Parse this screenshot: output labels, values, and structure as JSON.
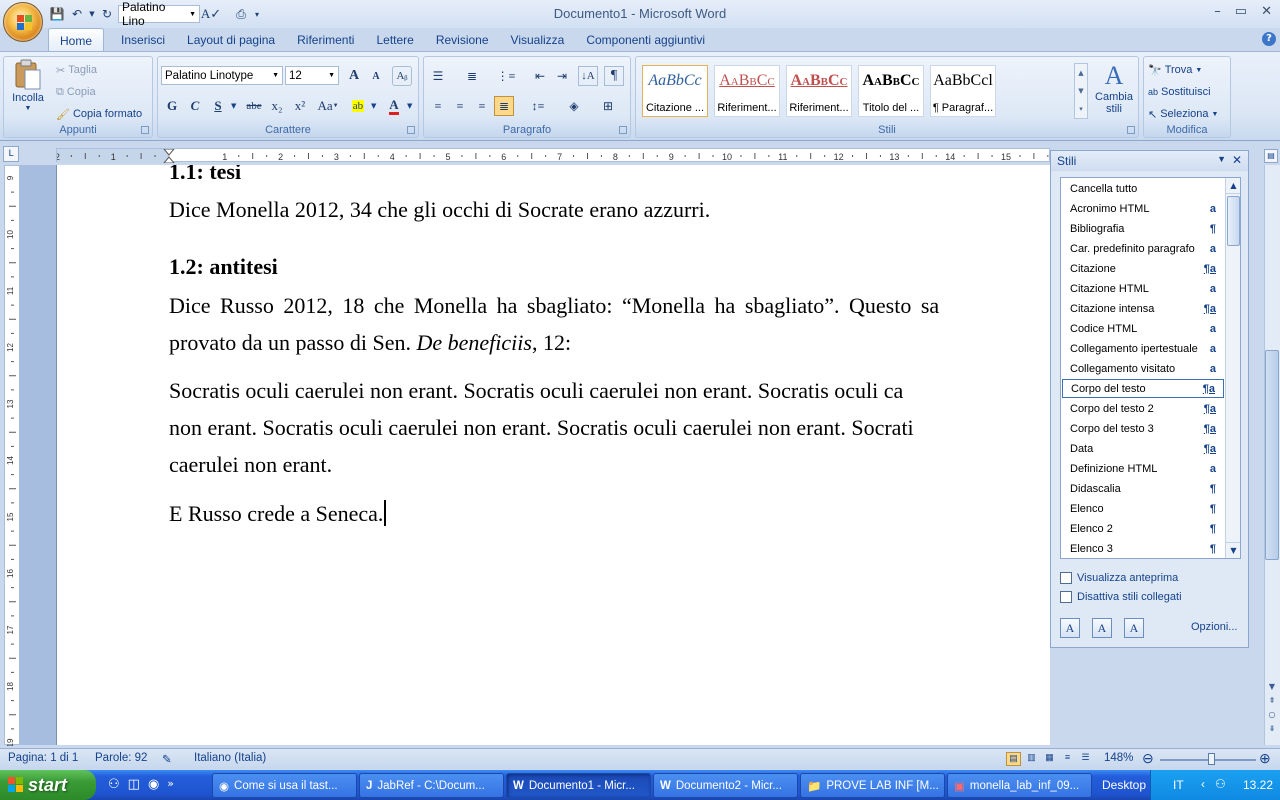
{
  "window": {
    "title": "Documento1 - Microsoft Word",
    "qat_font": "Palatino Lino"
  },
  "tabs": [
    "Home",
    "Inserisci",
    "Layout di pagina",
    "Riferimenti",
    "Lettere",
    "Revisione",
    "Visualizza",
    "Componenti aggiuntivi"
  ],
  "ribbon": {
    "clipboard": {
      "label": "Appunti",
      "paste": "Incolla",
      "cut": "Taglia",
      "copy": "Copia",
      "format_painter": "Copia formato"
    },
    "font": {
      "label": "Carattere",
      "name": "Palatino Linotype",
      "size": "12",
      "bold": "G",
      "italic": "C",
      "underline": "S",
      "strike": "abe",
      "subscript": "x₂",
      "superscript": "x²",
      "case": "Aa",
      "grow": "A",
      "shrink": "A"
    },
    "paragraph": {
      "label": "Paragrafo"
    },
    "styles": {
      "label": "Stili",
      "tiles": [
        {
          "sample": "AaBbCc",
          "name": "Citazione ...",
          "color": "#2f5f9e"
        },
        {
          "sample": "AaBbCc",
          "name": "Riferiment...",
          "color": "#c0504d"
        },
        {
          "sample": "AaBbCc",
          "name": "Riferiment...",
          "color": "#c0504d"
        },
        {
          "sample": "AaBbCc",
          "name": "Titolo del ...",
          "color": "#000000"
        },
        {
          "sample": "AaBbCcl",
          "name": "¶ Paragraf...",
          "color": "#000000"
        }
      ],
      "change": "Cambia",
      "change2": "stili"
    },
    "edit": {
      "label": "Modifica",
      "find": "Trova",
      "replace": "Sostituisci",
      "select": "Seleziona"
    }
  },
  "document": {
    "h1": "1.1: tesi",
    "p1": "Dice Monella 2012, 34 che gli occhi di Socrate erano azzurri.",
    "h2": "1.2: antitesi",
    "p2a": "Dice Russo 2012, 18 che Monella ha sbagliato: “Monella ha sbagliato”. Questo sa",
    "p2b_start": "provato da un passo di Sen. ",
    "p2b_italic": "De beneficiis",
    "p2b_end": ", 12:",
    "q1": "Socratis oculi caerulei non erant. Socratis oculi caerulei non erant. Socratis oculi ca",
    "q2": "non erant. Socratis oculi caerulei non erant. Socratis oculi caerulei non erant. Socrati",
    "q3": "caerulei non erant.",
    "p3": "E Russo crede a Seneca."
  },
  "styles_pane": {
    "title": "Stili",
    "items": [
      {
        "name": "Cancella tutto",
        "mark": ""
      },
      {
        "name": "Acronimo HTML",
        "mark": "a"
      },
      {
        "name": "Bibliografia",
        "mark": "¶"
      },
      {
        "name": "Car. predefinito paragrafo",
        "mark": "a"
      },
      {
        "name": "Citazione",
        "mark": "¶a"
      },
      {
        "name": "Citazione HTML",
        "mark": "a"
      },
      {
        "name": "Citazione intensa",
        "mark": "¶a"
      },
      {
        "name": "Codice HTML",
        "mark": "a"
      },
      {
        "name": "Collegamento ipertestuale",
        "mark": "a"
      },
      {
        "name": "Collegamento visitato",
        "mark": "a"
      },
      {
        "name": "Corpo del testo",
        "mark": "¶a",
        "selected": true
      },
      {
        "name": "Corpo del testo 2",
        "mark": "¶a"
      },
      {
        "name": "Corpo del testo 3",
        "mark": "¶a"
      },
      {
        "name": "Data",
        "mark": "¶a"
      },
      {
        "name": "Definizione HTML",
        "mark": "a"
      },
      {
        "name": "Didascalia",
        "mark": "¶"
      },
      {
        "name": "Elenco",
        "mark": "¶"
      },
      {
        "name": "Elenco 2",
        "mark": "¶"
      },
      {
        "name": "Elenco 3",
        "mark": "¶"
      }
    ],
    "preview": "Visualizza anteprima",
    "disable_linked": "Disattiva stili collegati",
    "options": "Opzioni..."
  },
  "status": {
    "page": "Pagina: 1 di 1",
    "words": "Parole: 92",
    "lang": "Italiano (Italia)",
    "zoom": "148%"
  },
  "taskbar": {
    "start": "start",
    "tasks": [
      "Come si usa il tast...",
      "JabRef - C:\\Docum...",
      "Documento1 - Micr...",
      "Documento2 - Micr...",
      "PROVE LAB INF [M...",
      "monella_lab_inf_09..."
    ],
    "desktop": "Desktop",
    "lang": "IT",
    "clock": "13.22"
  },
  "ruler": {
    "h_ticks": [
      "2",
      "1",
      "1",
      "2",
      "3",
      "4",
      "5",
      "6",
      "7",
      "8",
      "9",
      "10",
      "11",
      "12",
      "13",
      "14",
      "15"
    ],
    "v_ticks": [
      "9",
      "10",
      "11",
      "12",
      "13",
      "14",
      "15",
      "16",
      "17",
      "18",
      "19"
    ]
  },
  "colors": {
    "accent": "#15428b",
    "ribbon": "#dbe6f5",
    "taskbar": "#245edb"
  }
}
